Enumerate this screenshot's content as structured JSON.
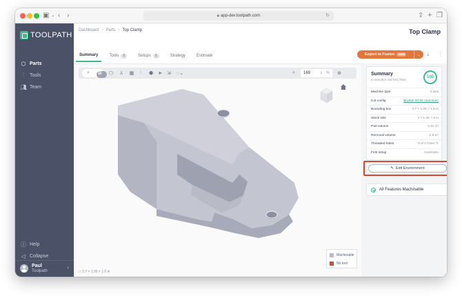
{
  "browser": {
    "url": "app-dev.toolpath.com"
  },
  "sidebar": {
    "logo": "TOOLPATH",
    "items": [
      {
        "label": "Parts",
        "icon": "cube-icon"
      },
      {
        "label": "Tools",
        "icon": "tool-icon"
      },
      {
        "label": "Team",
        "icon": "team-icon"
      }
    ],
    "bottom": [
      {
        "label": "Help",
        "icon": "help-icon"
      },
      {
        "label": "Collapse",
        "icon": "collapse-icon"
      }
    ],
    "user": {
      "name": "Paul",
      "org": "Toolpath"
    }
  },
  "header": {
    "breadcrumb": [
      "Dashboard",
      "Parts",
      "Top Clamp"
    ],
    "title": "Top Clamp",
    "tabs": [
      {
        "label": "Summary",
        "count": ""
      },
      {
        "label": "Tools",
        "count": "0"
      },
      {
        "label": "Setups",
        "count": "0"
      },
      {
        "label": "Strategy",
        "count": ""
      },
      {
        "label": "Estimate",
        "count": ""
      }
    ],
    "export_label": "Export to Fusion",
    "export_badge": "Beta"
  },
  "viewer": {
    "zoom_value": "169",
    "zoom_unit": "%",
    "dimensions": "3.7 × 1.05 × 1.6 in",
    "legend": [
      {
        "label": "Machinable",
        "color": "#b9bcc8"
      },
      {
        "label": "No tool",
        "color": "#c0503a"
      }
    ]
  },
  "summary": {
    "title": "Summary",
    "subtitle": "0 ISSUES DETECTED",
    "score": "100",
    "rows": [
      {
        "key": "Machine type",
        "value": "3 axis"
      },
      {
        "key": "Cut config",
        "value": "Brother BT30 Aluminum"
      },
      {
        "key": "Bounding box",
        "value": "3.7 × 1.05 × 1.6 in"
      },
      {
        "key": "Stock size",
        "value": "4 × 1.25 × 2 in"
      },
      {
        "key": "Part volume",
        "value": "3.31 in³"
      },
      {
        "key": "Removal volume",
        "value": "2.9 in³"
      },
      {
        "key": "Threaded holes",
        "value": "0 of 4 holes"
      },
      {
        "key": "First setup",
        "value": "Automatic"
      }
    ],
    "edit_label": "Edit Environment",
    "all_features": "All Features Machinable"
  }
}
